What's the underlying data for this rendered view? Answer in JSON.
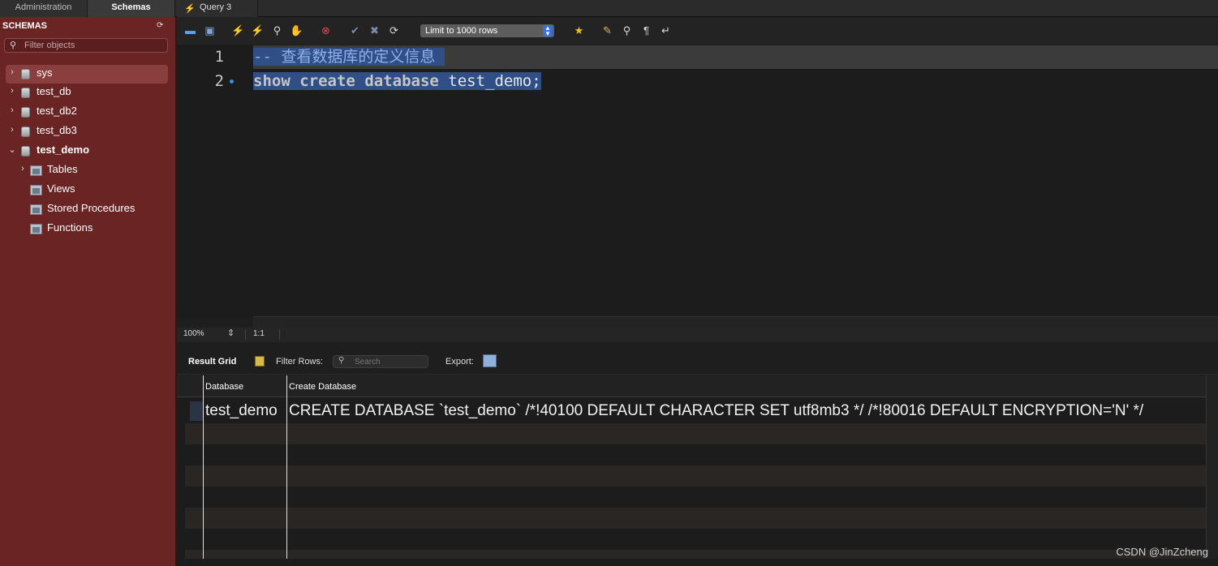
{
  "tabs": {
    "administration": "Administration",
    "schemas": "Schemas",
    "query": "Query 3"
  },
  "sidebar": {
    "title": "SCHEMAS",
    "filter_placeholder": "Filter objects",
    "schemas": [
      {
        "name": "sys",
        "expanded": false,
        "selected": true
      },
      {
        "name": "test_db",
        "expanded": false
      },
      {
        "name": "test_db2",
        "expanded": false
      },
      {
        "name": "test_db3",
        "expanded": false
      },
      {
        "name": "test_demo",
        "expanded": true
      }
    ],
    "children": [
      {
        "name": "Tables",
        "expandable": true
      },
      {
        "name": "Views"
      },
      {
        "name": "Stored Procedures"
      },
      {
        "name": "Functions"
      }
    ]
  },
  "toolbar": {
    "limit_label": "Limit to 1000 rows"
  },
  "editor": {
    "line_numbers": [
      "1",
      "2"
    ],
    "line1": "-- 查看数据库的定义信息",
    "line2_kw1": "show",
    "line2_kw2": "create",
    "line2_kw3": "database",
    "line2_name": "test_demo;"
  },
  "statusbar": {
    "zoom": "100%",
    "cursor": "1:1"
  },
  "results": {
    "result_grid_label": "Result Grid",
    "filter_rows_label": "Filter Rows:",
    "search_placeholder": "Search",
    "export_label": "Export:",
    "columns": [
      "Database",
      "Create Database"
    ],
    "rows": [
      [
        "test_demo",
        "CREATE DATABASE `test_demo` /*!40100 DEFAULT CHARACTER SET utf8mb3 */ /*!80016 DEFAULT ENCRYPTION='N' */"
      ]
    ]
  },
  "watermark": "CSDN @JinZcheng"
}
